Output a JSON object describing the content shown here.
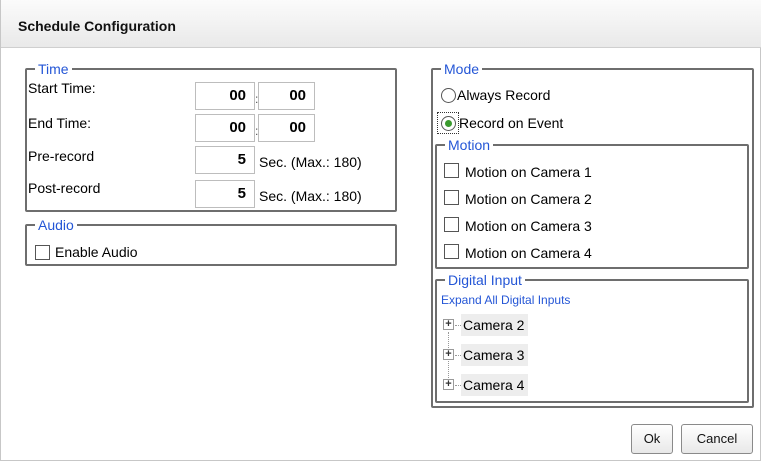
{
  "dialog": {
    "title": "Schedule Configuration"
  },
  "time": {
    "legend": "Time",
    "start_label": "Start Time:",
    "start_hour": "00",
    "start_minute": "00",
    "end_label": "End Time:",
    "end_hour": "00",
    "end_minute": "00",
    "colon": ":",
    "prerecord_label": "Pre-record",
    "prerecord_value": "5",
    "prerecord_unit": "Sec. (Max.: 180)",
    "postrecord_label": "Post-record",
    "postrecord_value": "5",
    "postrecord_unit": "Sec. (Max.: 180)"
  },
  "audio": {
    "legend": "Audio",
    "enable_label": "Enable Audio",
    "enabled": false
  },
  "mode": {
    "legend": "Mode",
    "options": [
      {
        "label": "Always Record",
        "selected": false
      },
      {
        "label": "Record on Event",
        "selected": true
      }
    ]
  },
  "motion": {
    "legend": "Motion",
    "items": [
      {
        "label": "Motion on Camera 1",
        "checked": false
      },
      {
        "label": "Motion on Camera 2",
        "checked": false
      },
      {
        "label": "Motion on Camera 3",
        "checked": false
      },
      {
        "label": "Motion on Camera 4",
        "checked": false
      }
    ]
  },
  "digital_input": {
    "legend": "Digital Input",
    "expand_all_label": "Expand All Digital Inputs",
    "tree": [
      {
        "label": "Camera 2",
        "expander": "+"
      },
      {
        "label": "Camera 3",
        "expander": "+"
      },
      {
        "label": "Camera 4",
        "expander": "+"
      }
    ]
  },
  "buttons": {
    "ok_label": "Ok",
    "cancel_label": "Cancel"
  }
}
